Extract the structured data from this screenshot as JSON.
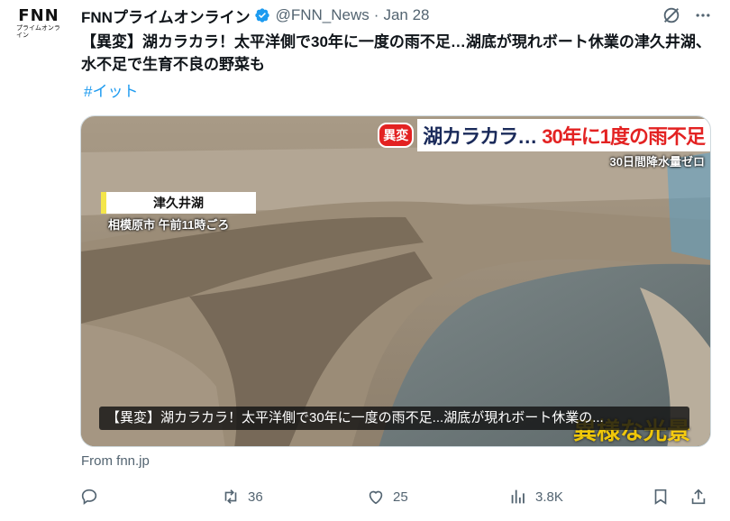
{
  "account": {
    "avatar_logo": "FNN",
    "avatar_sub": "プライムオンライン",
    "name": "FNNプライムオンライン",
    "handle": "@FNN_News",
    "separator": "·",
    "date": "Jan 28"
  },
  "tweet": {
    "text": "【異変】湖カラカラ！太平洋側で30年に一度の雨不足…湖底が現れボート休業の津久井湖、水不足で生育不良の野菜も",
    "hashtag": "#イット"
  },
  "media": {
    "banner_tag": "異変",
    "banner_title_a": "湖カラカラ…",
    "banner_title_b": "30年に1度の雨不足",
    "banner_sub": "30日間降水量ゼロ",
    "location_label": "津久井湖",
    "location_sub": "相模原市 午前11時ごろ",
    "bottom_super": "異様な光景",
    "caption": "【異変】湖カラカラ！太平洋側で30年に一度の雨不足...湖底が現れボート休業の..."
  },
  "source": "From fnn.jp",
  "actions": {
    "reply_count": "",
    "retweet_count": "36",
    "like_count": "25",
    "views_count": "3.8K"
  },
  "colors": {
    "accent": "#1d9bf0",
    "muted": "#536471",
    "text": "#0f1419",
    "banner_red": "#e32222"
  }
}
